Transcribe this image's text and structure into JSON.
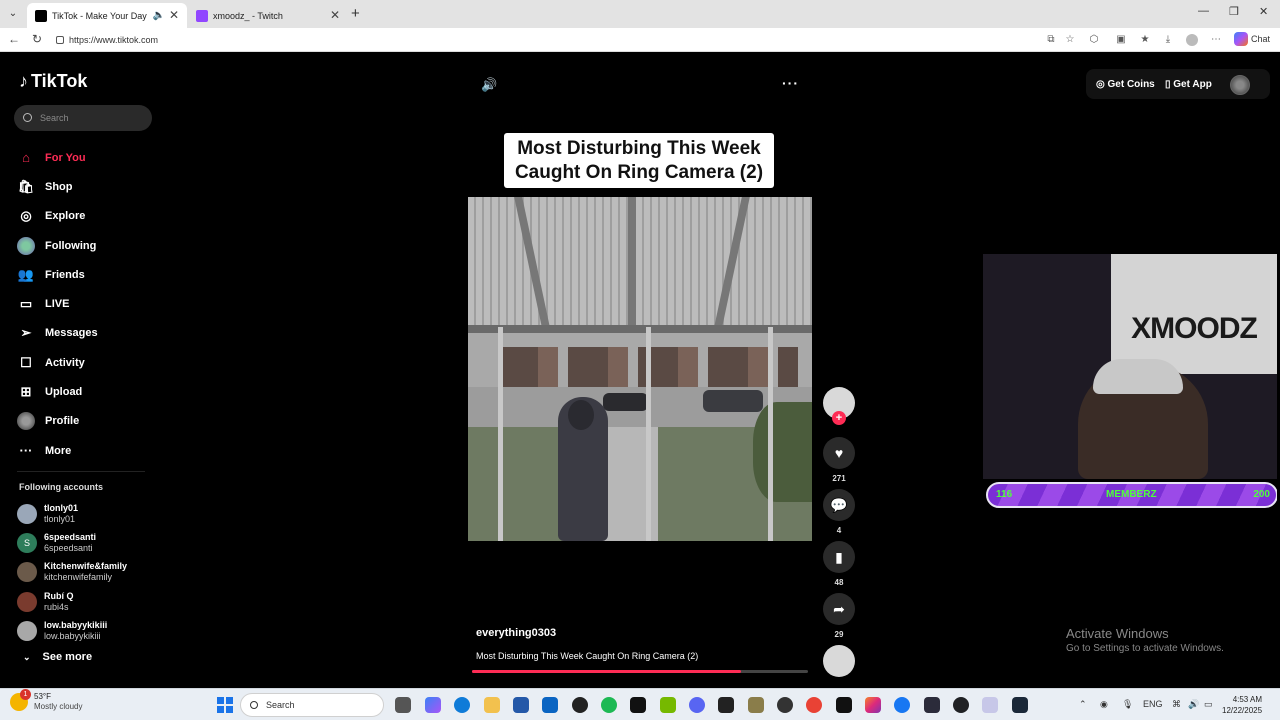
{
  "browser": {
    "tabs": [
      {
        "title": "TikTok - Make Your Day",
        "active": true
      },
      {
        "title": "xmoodz_ - Twitch",
        "active": false
      }
    ],
    "url": "https://www.tiktok.com",
    "chat_label": "Chat"
  },
  "tiktok": {
    "brand": "TikTok",
    "search_placeholder": "Search",
    "nav": [
      {
        "label": "For You",
        "icon": "home-icon",
        "active": true
      },
      {
        "label": "Shop",
        "icon": "shop-icon",
        "active": false
      },
      {
        "label": "Explore",
        "icon": "compass-icon",
        "active": false
      },
      {
        "label": "Following",
        "icon": "following-avatar-icon",
        "active": false
      },
      {
        "label": "Friends",
        "icon": "friends-icon",
        "active": false
      },
      {
        "label": "LIVE",
        "icon": "live-icon",
        "active": false
      },
      {
        "label": "Messages",
        "icon": "messages-icon",
        "active": false
      },
      {
        "label": "Activity",
        "icon": "activity-icon",
        "active": false
      },
      {
        "label": "Upload",
        "icon": "upload-icon",
        "active": false
      },
      {
        "label": "Profile",
        "icon": "profile-icon",
        "active": false
      },
      {
        "label": "More",
        "icon": "more-icon",
        "active": false
      }
    ],
    "following_title": "Following accounts",
    "following": [
      {
        "name": "tlonly01",
        "handle": "tlonly01",
        "color": "#9aa7b8"
      },
      {
        "name": "6speedsanti",
        "handle": "6speedsanti",
        "color": "#2e7d5b"
      },
      {
        "name": "Kitchenwife&family",
        "handle": "kitchenwifefamily",
        "color": "#6b5a4a"
      },
      {
        "name": "Rubí Q",
        "handle": "rubi4s",
        "color": "#7a3b2e"
      },
      {
        "name": "low.babyykikiii",
        "handle": "low.babyykikiii",
        "color": "#a8a8a8"
      }
    ],
    "see_more": "See more",
    "top_right": {
      "coins": "Get Coins",
      "app": "Get App"
    },
    "video": {
      "title_overlay": "Most Disturbing This Week\nCaught On Ring Camera (2)",
      "title_line1": "Most Disturbing This Week",
      "title_line2": "Caught On Ring Camera (2)",
      "author": "everything0303",
      "caption": "Most Disturbing This Week Caught On Ring Camera (2)",
      "progress": 0.8
    },
    "actions": {
      "likes": "271",
      "comments": "4",
      "saves": "48",
      "shares": "29"
    }
  },
  "stream_overlay": {
    "logo_text": "XMOODZ",
    "bar_left": "116",
    "bar_label": "MEMBERZ",
    "bar_right": "200"
  },
  "windows": {
    "activate_title": "Activate Windows",
    "activate_sub": "Go to Settings to activate Windows.",
    "weather_temp": "53°F",
    "weather_desc": "Mostly cloudy",
    "weather_badge": "1",
    "search_label": "Search",
    "lang": "ENG",
    "time": "4:53 AM",
    "date": "12/22/2025"
  }
}
